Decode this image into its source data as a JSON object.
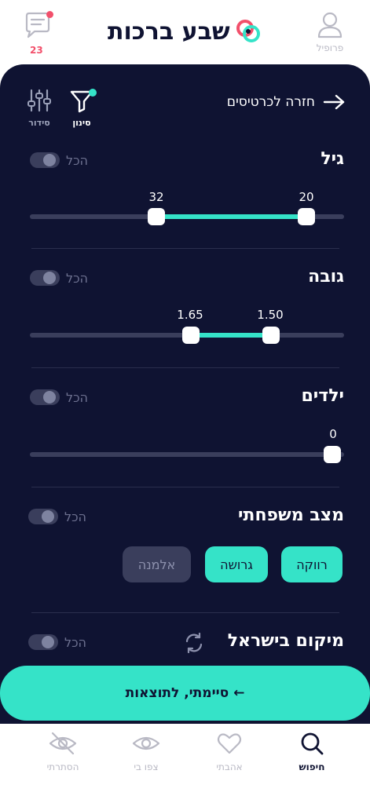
{
  "header": {
    "app_title": "שבע ברכות",
    "messages_count": "23",
    "profile_label": "פרופיל"
  },
  "toolbar": {
    "back_label": "חזרה לכרטיסים",
    "filter_label": "סינון",
    "sort_label": "סידור"
  },
  "filters": {
    "age": {
      "title": "גיל",
      "all_label": "הכל",
      "all_enabled": false,
      "min": "20",
      "max": "32"
    },
    "height": {
      "title": "גובה",
      "all_label": "הכל",
      "all_enabled": false,
      "min": "1.50",
      "max": "1.65"
    },
    "children": {
      "title": "ילדים",
      "all_label": "הכל",
      "all_enabled": false,
      "value": "0"
    },
    "marital": {
      "title": "מצב משפחתי",
      "all_label": "הכל",
      "all_enabled": false,
      "options": [
        {
          "label": "רווקה",
          "selected": true
        },
        {
          "label": "גרושה",
          "selected": true
        },
        {
          "label": "אלמנה",
          "selected": false
        }
      ]
    },
    "location": {
      "title": "מיקום בישראל",
      "all_label": "הכל",
      "all_enabled": false
    }
  },
  "cta": {
    "label": "סיימתי, לתוצאות ←"
  },
  "bottom_nav": {
    "search": "חיפוש",
    "liked": "אהבתי",
    "viewed_me": "צפו בי",
    "hidden": "הסתרתי"
  },
  "colors": {
    "accent": "#35e3c8",
    "panel": "#0f1332",
    "badge": "#f2506b"
  }
}
